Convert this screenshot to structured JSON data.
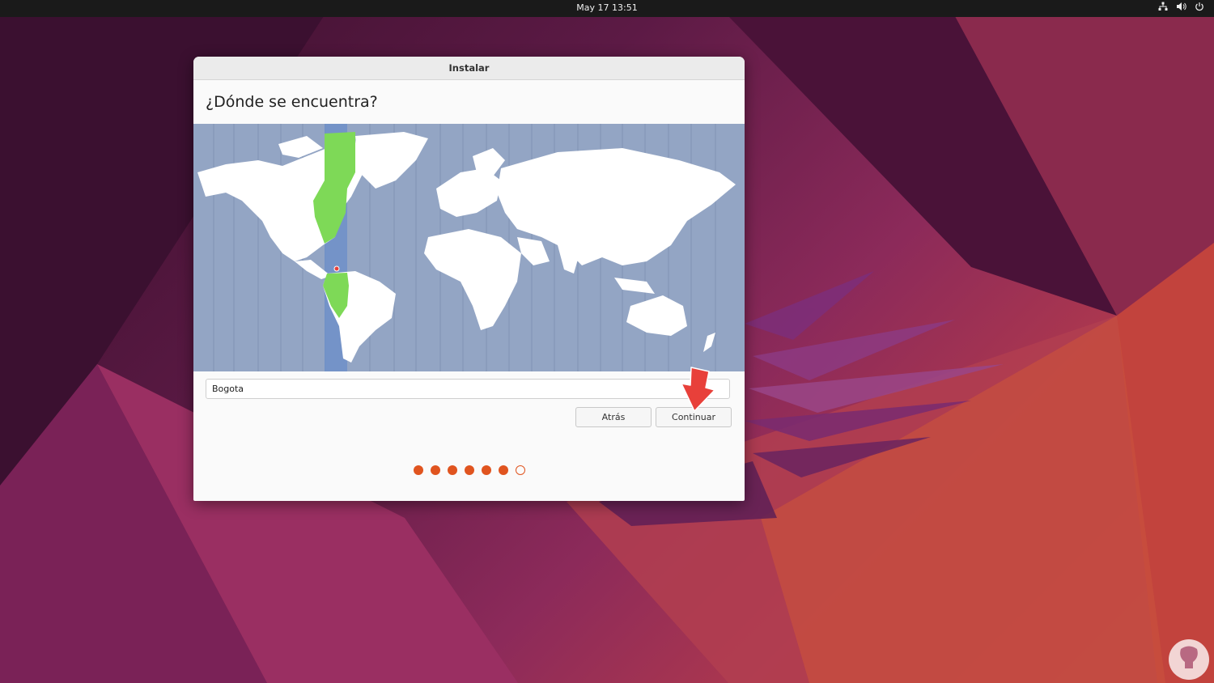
{
  "topbar": {
    "clock": "May 17  13:51",
    "icons": [
      "network-icon",
      "volume-icon",
      "power-icon"
    ]
  },
  "window": {
    "title": "Instalar",
    "heading": "¿Dónde se encuentra?",
    "timezone_input": {
      "value": "Bogota",
      "placeholder": ""
    },
    "back_label": "Atrás",
    "continue_label": "Continuar",
    "steps_total": 7,
    "steps_done": 6
  },
  "colors": {
    "accent": "#e0541f",
    "map_ocean": "#93a5c4",
    "selected_zone": "#6f8fc9",
    "selected_land": "#7ed957",
    "annotation_arrow": "#e8403a"
  }
}
